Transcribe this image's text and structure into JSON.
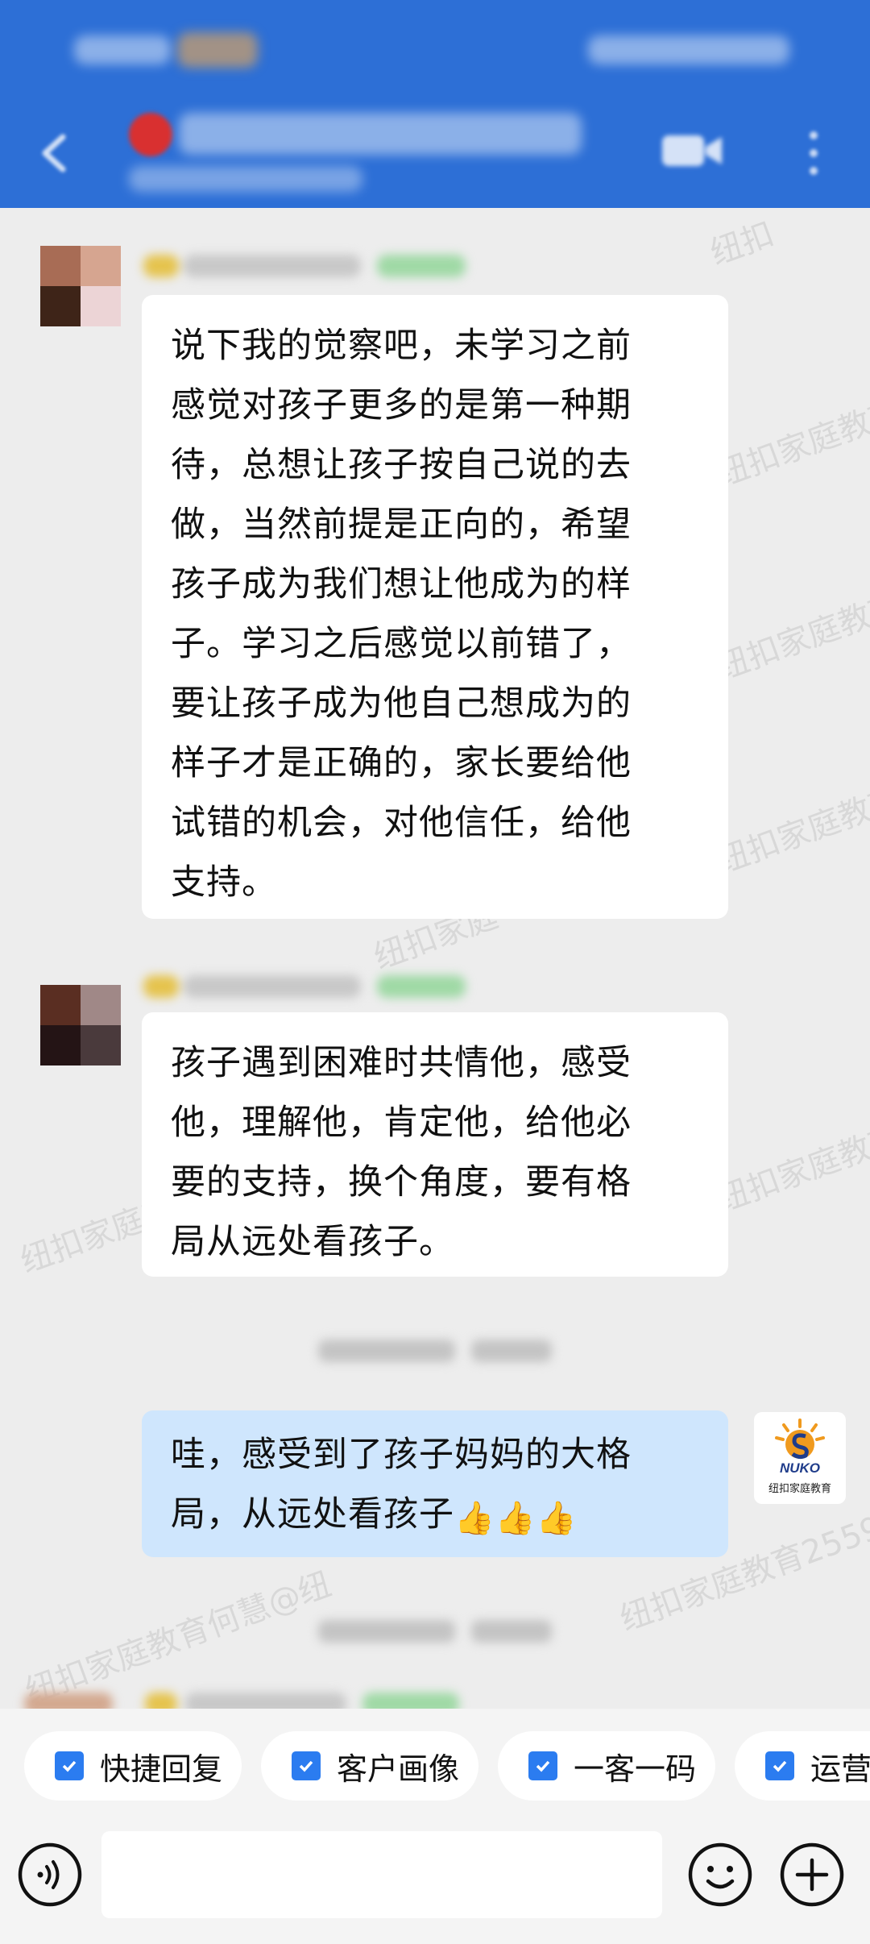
{
  "chat": {
    "messages": [
      {
        "lines": [
          "说下我的觉察吧，未学习之前",
          "感觉对孩子更多的是第一种期",
          "待，总想让孩子按自己说的去",
          "做，当然前提是正向的，希望",
          "孩子成为我们想让他成为的样",
          "子。学习之后感觉以前错了，",
          "要让孩子成为他自己想成为的",
          "样子才是正确的，家长要给他",
          "试错的机会，对他信任，给他",
          "支持。"
        ]
      },
      {
        "lines": [
          "孩子遇到困难时共情他，感受",
          "他，理解他，肯定他，给他必",
          "要的支持，换个角度，要有格",
          "局从远处看孩子。"
        ]
      },
      {
        "lines": [
          "哇，感受到了孩子妈妈的大格",
          "局，从远处看孩子"
        ],
        "emoji": [
          "👍",
          "👍",
          "👍"
        ]
      }
    ],
    "self_avatar": {
      "brand": "NUKO",
      "subtitle": "纽扣家庭教育"
    },
    "watermark_text": "纽扣家庭教育2559"
  },
  "quick_actions": [
    {
      "label": "快捷回复"
    },
    {
      "label": "客户画像"
    },
    {
      "label": "一客一码"
    },
    {
      "label": "运营"
    }
  ],
  "colors": {
    "header": "#2d6fd6",
    "self_bubble": "#cfe6fd",
    "check": "#2b7cf0"
  }
}
